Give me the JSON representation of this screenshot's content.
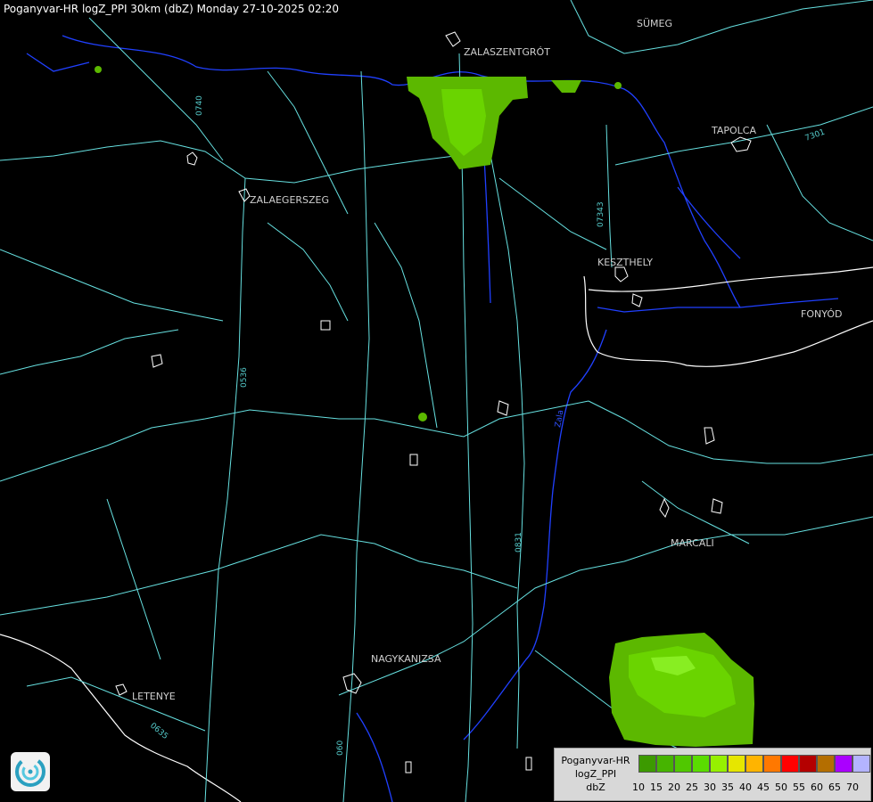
{
  "title": "Poganyvar-HR logZ_PPI 30km (dbZ) Monday 27-10-2025 02:20",
  "towns": [
    "SÜMEG",
    "ZALASZENTGRÓT",
    "TAPOLCA",
    "ZALAEGERSZEG",
    "KESZTHELY",
    "FONYÓD",
    "MARCALI",
    "NAGYKANIZSA",
    "LETENYE"
  ],
  "road_labels": [
    "0740",
    "7301",
    "07343",
    "0536",
    "0831",
    "0635",
    "060",
    "Zala"
  ],
  "legend": {
    "label_lines": [
      "Poganyvar-HR",
      "logZ_PPI",
      "dbZ"
    ],
    "ticks": [
      "10",
      "15",
      "20",
      "25",
      "30",
      "35",
      "40",
      "45",
      "50",
      "55",
      "60",
      "65",
      "70"
    ],
    "colors": [
      "#3c9a00",
      "#46b400",
      "#50c800",
      "#5adc00",
      "#96f000",
      "#e6e600",
      "#ffb400",
      "#ff7800",
      "#ff0000",
      "#b40000",
      "#b46e00",
      "#aa00ff",
      "#b4b4ff"
    ]
  },
  "colors": {
    "road": "#66e0e0",
    "river": "#2040ff",
    "border": "#ffffff",
    "echo_low": "#5cb800",
    "echo_mid": "#6ad400",
    "echo_high": "#88ee22"
  },
  "logo_icon": "radar-swirl-icon"
}
